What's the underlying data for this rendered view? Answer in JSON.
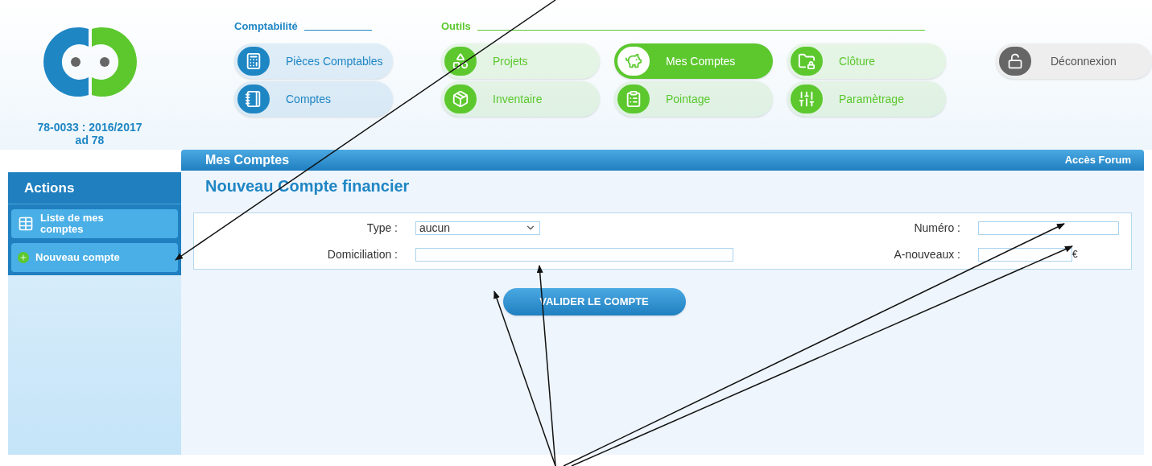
{
  "account": {
    "code": "78-0033 : 2016/2017",
    "name": "ad 78"
  },
  "nav_groups": [
    {
      "title": "Comptabilité",
      "color": "#1f86c4",
      "items": [
        {
          "label": "Pièces Comptables",
          "selected": false
        },
        {
          "label": "Comptes",
          "selected": false
        }
      ]
    },
    {
      "title": "Outils",
      "color": "#5cc82e",
      "items": [
        {
          "label": "Projets",
          "selected": false
        },
        {
          "label": "Inventaire",
          "selected": false
        },
        {
          "label": "Mes Comptes",
          "selected": true
        },
        {
          "label": "Pointage",
          "selected": false
        },
        {
          "label": "Clôture",
          "selected": false
        },
        {
          "label": "Paramètrage",
          "selected": false
        }
      ]
    }
  ],
  "logout": {
    "label": "Déconnexion"
  },
  "sidebar": {
    "title": "Actions",
    "items": [
      {
        "label": "Liste de mes comptes",
        "kind": "list"
      },
      {
        "label": "Nouveau compte",
        "kind": "add"
      }
    ]
  },
  "page": {
    "section": "Mes Comptes",
    "forum_link": "Accès Forum",
    "title": "Nouveau Compte financier"
  },
  "form": {
    "type": {
      "label": "Type :",
      "value": "aucun"
    },
    "domiciliation": {
      "label": "Domiciliation :"
    },
    "numero": {
      "label": "Numéro :"
    },
    "a_nouveaux": {
      "label": "A-nouveaux :",
      "unit": "€"
    },
    "submit": "VALIDER LE COMPTE"
  }
}
